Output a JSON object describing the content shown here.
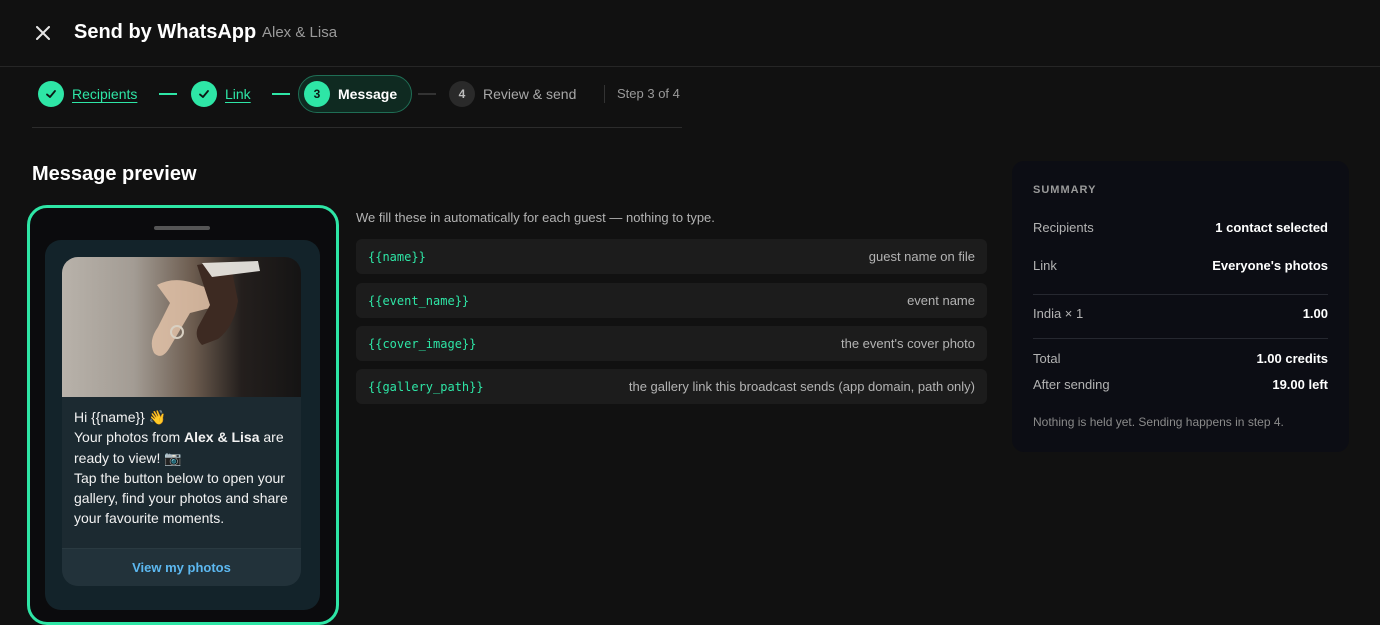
{
  "header": {
    "title": "Send by WhatsApp",
    "subtitle": "Alex & Lisa",
    "close_icon": "close-icon"
  },
  "stepper": {
    "steps": [
      {
        "number": "1",
        "label": "Recipients",
        "state": "done"
      },
      {
        "number": "2",
        "label": "Link",
        "state": "done"
      },
      {
        "number": "3",
        "label": "Message",
        "state": "active"
      },
      {
        "number": "4",
        "label": "Review & send",
        "state": "todo"
      }
    ],
    "step_count": "Step 3 of 4"
  },
  "preview": {
    "title": "Message preview",
    "message": {
      "line1": "Hi {{name}}",
      "line1_emoji": "👋",
      "line2_prefix": "Your photos from ",
      "line2_bold": "Alex & Lisa",
      "line2_suffix": " are ready to view!",
      "line2_emoji": "📷",
      "line3": "Tap the button below to open your gallery, find your photos and share your favourite moments."
    },
    "button_label": "View my photos"
  },
  "variables": {
    "intro": "We fill these in automatically for each guest — nothing to type.",
    "items": [
      {
        "token": "{{name}}",
        "description": "guest name on file"
      },
      {
        "token": "{{event_name}}",
        "description": "event name"
      },
      {
        "token": "{{cover_image}}",
        "description": "the event's cover photo"
      },
      {
        "token": "{{gallery_path}}",
        "description": "the gallery link this broadcast sends (app domain, path only)"
      }
    ]
  },
  "summary": {
    "heading": "SUMMARY",
    "recipients_label": "Recipients",
    "recipients_value": "1 contact selected",
    "link_label": "Link",
    "link_value": "Everyone's photos",
    "country_label": "India × 1",
    "country_value": "1.00",
    "total_label": "Total",
    "total_value": "1.00 credits",
    "after_label": "After sending",
    "after_value": "19.00 left",
    "note": "Nothing is held yet. Sending happens in step 4."
  },
  "colors": {
    "accent": "#2ee6a6",
    "background": "#111111",
    "link_blue": "#5cb8f0"
  }
}
